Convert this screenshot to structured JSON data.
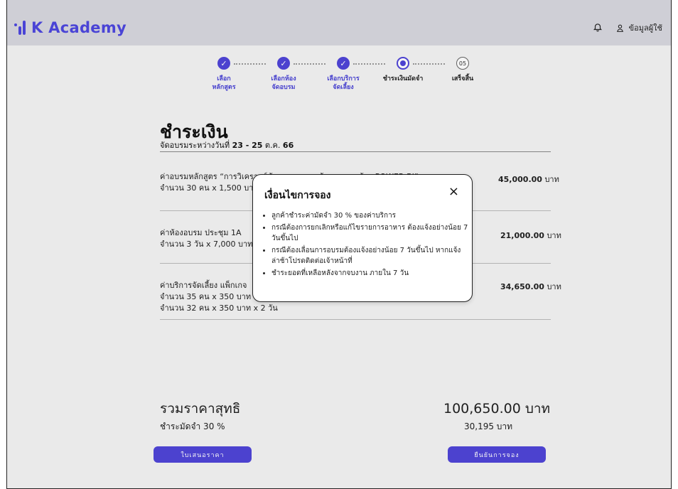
{
  "header": {
    "brand": "K Academy",
    "user_label": "ข้อมูลผู้ใช้",
    "icons": [
      "bell-icon",
      "user-icon"
    ]
  },
  "stepper": [
    {
      "label_line1": "เลือก",
      "label_line2": "หลักสูตร",
      "state": "done"
    },
    {
      "label_line1": "เลือกห้อง",
      "label_line2": "จัดอบรม",
      "state": "done"
    },
    {
      "label_line1": "เลือกบริการ",
      "label_line2": "จัดเลี้ยง",
      "state": "done"
    },
    {
      "label_line1": "ชำระเงินมัดจำ",
      "label_line2": "",
      "state": "active"
    },
    {
      "label_line1": "เสร็จสิ้น",
      "label_line2": "",
      "state": "pending",
      "number": "05"
    }
  ],
  "payment": {
    "title": "ชำระเงิน",
    "subtitle_prefix": "จัดอบรมระหว่างวันที่",
    "date_range": "23 - 25",
    "month": "ต.ค.",
    "year": "66",
    "items": [
      {
        "line1": "ค่าอบรมหลักสูตร “การวิเคราะห์ข้อมูลและการสร้างรายงานด้วย POWER BI”",
        "line2": "จำนวน 30 คน x 1,500 บาท",
        "amount": "45,000.00",
        "unit": "บาท"
      },
      {
        "line1": "ค่าห้องอบรม ประชุม 1A",
        "line2": "จำนวน 3 วัน x 7,000 บาท",
        "amount": "21,000.00",
        "unit": "บาท"
      },
      {
        "line1": "ค่าบริการจัดเลี้ยง แพ็กเกจ",
        "line2": "จำนวน 35 คน x 350 บาท",
        "line3": "จำนวน 32 คน x 350 บาท x 2 วัน",
        "amount": "34,650.00",
        "unit": "บาท"
      }
    ],
    "total_label": "รวมราคาสุทธิ",
    "total_value": "100,650.00 บาท",
    "deposit_label": "ชำระมัดจำ 30 %",
    "deposit_value": "30,195 บาท",
    "quote_button": "ใบเสนอราคา",
    "confirm_button": "ยืนยันการจอง"
  },
  "modal": {
    "title": "เงื่อนไขการจอง",
    "close": "×",
    "items": [
      "ลูกค้าชำระค่ามัดจำ 30 % ของค่าบริการ",
      "กรณีต้องการยกเลิกหรือแก้ไขรายการอาหาร ต้องแจ้งอย่างน้อย 7 วันขึ้นไป",
      "กรณีต้องเลื่อนการอบรมต้องแจ้งอย่างน้อย 7 วันขึ้นไป หากแจ้งล่าช้าโปรดติดต่อเจ้าหน้าที่",
      "ชำระยอดที่เหลือหลังจากจบงาน ภายใน 7 วัน"
    ]
  },
  "colors": {
    "accent": "#5045d8",
    "header_bg": "#cfcfd6"
  }
}
